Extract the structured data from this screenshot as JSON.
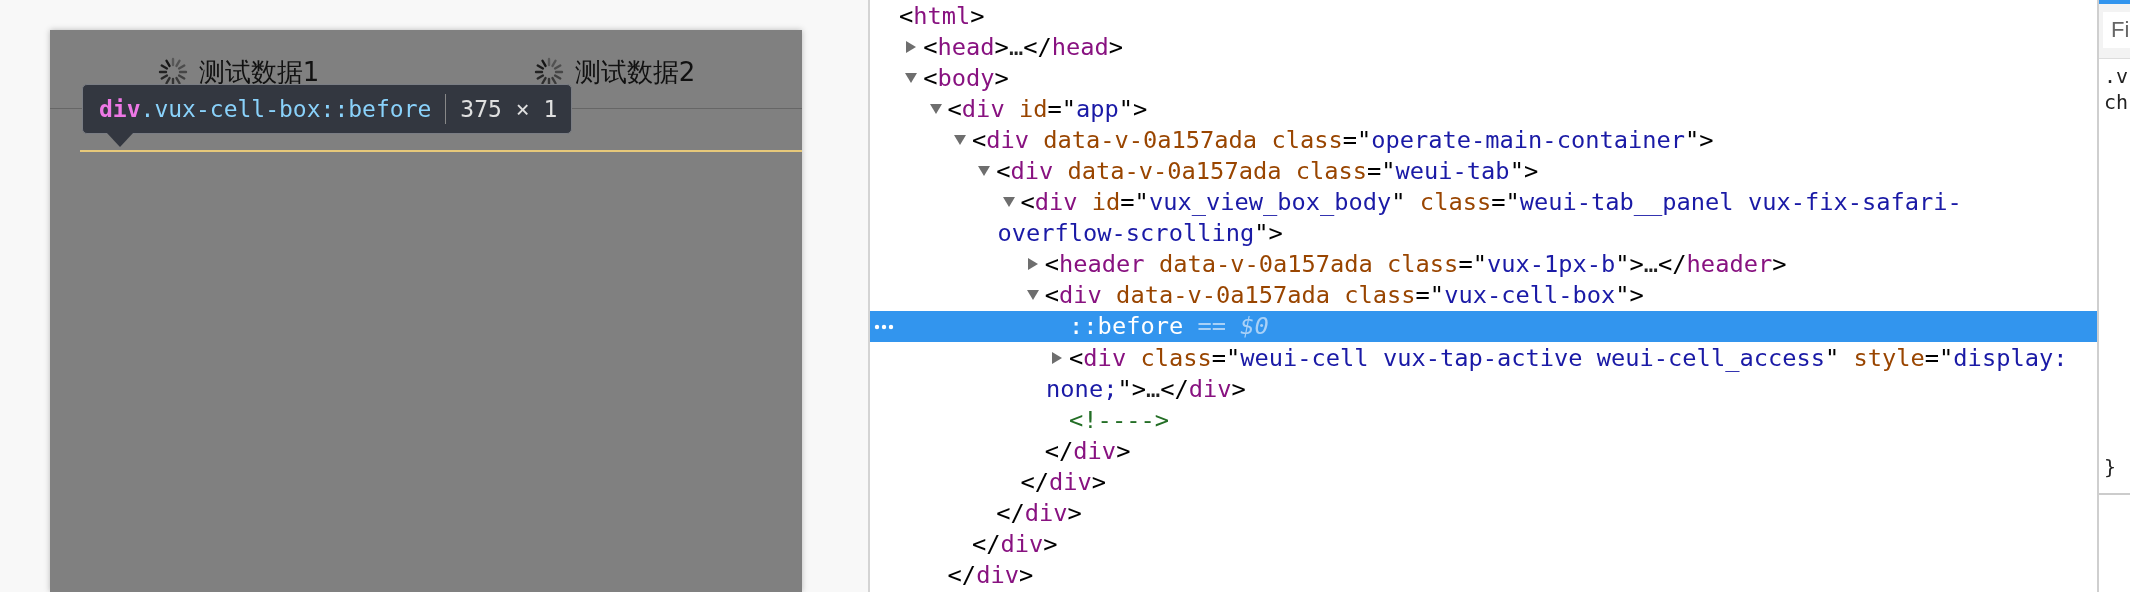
{
  "viewport": {
    "tabs": [
      {
        "label": "测试数据1"
      },
      {
        "label": "测试数据2"
      }
    ]
  },
  "tooltip": {
    "tag": "div",
    "selector": ".vux-cell-box::before",
    "size": "375 × 1"
  },
  "elements": {
    "nodes": [
      {
        "lines": [
          [
            {
              "kind": "punct",
              "text": "<"
            },
            {
              "kind": "tag",
              "text": "html"
            },
            {
              "kind": "punct",
              "text": ">"
            }
          ]
        ],
        "selected": false,
        "children": [
          {
            "expanded": false,
            "selected": false,
            "lines": [
              [
                {
                  "kind": "punct",
                  "text": "<"
                },
                {
                  "kind": "tag",
                  "text": "head"
                },
                {
                  "kind": "punct",
                  "text": ">"
                },
                {
                  "kind": "ellipsis",
                  "text": "…"
                },
                {
                  "kind": "punct",
                  "text": "</"
                },
                {
                  "kind": "tag",
                  "text": "head"
                },
                {
                  "kind": "punct",
                  "text": ">"
                }
              ]
            ]
          },
          {
            "expanded": true,
            "selected": false,
            "lines": [
              [
                {
                  "kind": "punct",
                  "text": "<"
                },
                {
                  "kind": "tag",
                  "text": "body"
                },
                {
                  "kind": "punct",
                  "text": ">"
                }
              ]
            ],
            "children": [
              {
                "expanded": true,
                "selected": false,
                "lines": [
                  [
                    {
                      "kind": "punct",
                      "text": "<"
                    },
                    {
                      "kind": "tag",
                      "text": "div"
                    },
                    {
                      "kind": "attr",
                      "text": " id"
                    },
                    {
                      "kind": "punct",
                      "text": "=\""
                    },
                    {
                      "kind": "value",
                      "text": "app"
                    },
                    {
                      "kind": "punct",
                      "text": "\">"
                    }
                  ]
                ],
                "close": [
                  {
                    "kind": "punct",
                    "text": "</"
                  },
                  {
                    "kind": "tag",
                    "text": "div"
                  },
                  {
                    "kind": "punct",
                    "text": ">"
                  }
                ],
                "children": [
                  {
                    "expanded": true,
                    "selected": false,
                    "lines": [
                      [
                        {
                          "kind": "punct",
                          "text": "<"
                        },
                        {
                          "kind": "tag",
                          "text": "div"
                        },
                        {
                          "kind": "attr",
                          "text": " data-v-0a157ada class"
                        },
                        {
                          "kind": "punct",
                          "text": "=\""
                        },
                        {
                          "kind": "value",
                          "text": "operate-main-container"
                        },
                        {
                          "kind": "punct",
                          "text": "\">"
                        }
                      ]
                    ],
                    "close": [
                      {
                        "kind": "punct",
                        "text": "</"
                      },
                      {
                        "kind": "tag",
                        "text": "div"
                      },
                      {
                        "kind": "punct",
                        "text": ">"
                      }
                    ],
                    "children": [
                      {
                        "expanded": true,
                        "selected": false,
                        "lines": [
                          [
                            {
                              "kind": "punct",
                              "text": "<"
                            },
                            {
                              "kind": "tag",
                              "text": "div"
                            },
                            {
                              "kind": "attr",
                              "text": " data-v-0a157ada class"
                            },
                            {
                              "kind": "punct",
                              "text": "=\""
                            },
                            {
                              "kind": "value",
                              "text": "weui-tab"
                            },
                            {
                              "kind": "punct",
                              "text": "\">"
                            }
                          ]
                        ],
                        "close": [
                          {
                            "kind": "punct",
                            "text": "</"
                          },
                          {
                            "kind": "tag",
                            "text": "div"
                          },
                          {
                            "kind": "punct",
                            "text": ">"
                          }
                        ],
                        "children": [
                          {
                            "expanded": true,
                            "selected": false,
                            "lines": [
                              [
                                {
                                  "kind": "punct",
                                  "text": "<"
                                },
                                {
                                  "kind": "tag",
                                  "text": "div"
                                },
                                {
                                  "kind": "attr",
                                  "text": " id"
                                },
                                {
                                  "kind": "punct",
                                  "text": "=\""
                                },
                                {
                                  "kind": "value",
                                  "text": "vux_view_box_body"
                                },
                                {
                                  "kind": "punct",
                                  "text": "\""
                                },
                                {
                                  "kind": "attr",
                                  "text": " class"
                                },
                                {
                                  "kind": "punct",
                                  "text": "=\""
                                },
                                {
                                  "kind": "value",
                                  "text": "weui-tab__panel vux-fix-safari-"
                                }
                              ],
                              [
                                {
                                  "kind": "value",
                                  "text": "overflow-scrolling"
                                },
                                {
                                  "kind": "punct",
                                  "text": "\">"
                                }
                              ]
                            ],
                            "close": [
                              {
                                "kind": "punct",
                                "text": "</"
                              },
                              {
                                "kind": "tag",
                                "text": "div"
                              },
                              {
                                "kind": "punct",
                                "text": ">"
                              }
                            ],
                            "children": [
                              {
                                "expanded": false,
                                "selected": false,
                                "lines": [
                                  [
                                    {
                                      "kind": "punct",
                                      "text": "<"
                                    },
                                    {
                                      "kind": "tag",
                                      "text": "header"
                                    },
                                    {
                                      "kind": "attr",
                                      "text": " data-v-0a157ada class"
                                    },
                                    {
                                      "kind": "punct",
                                      "text": "=\""
                                    },
                                    {
                                      "kind": "value",
                                      "text": "vux-1px-b"
                                    },
                                    {
                                      "kind": "punct",
                                      "text": "\">"
                                    },
                                    {
                                      "kind": "ellipsis",
                                      "text": "…"
                                    },
                                    {
                                      "kind": "punct",
                                      "text": "</"
                                    },
                                    {
                                      "kind": "tag",
                                      "text": "header"
                                    },
                                    {
                                      "kind": "punct",
                                      "text": ">"
                                    }
                                  ]
                                ]
                              },
                              {
                                "expanded": true,
                                "selected": false,
                                "lines": [
                                  [
                                    {
                                      "kind": "punct",
                                      "text": "<"
                                    },
                                    {
                                      "kind": "tag",
                                      "text": "div"
                                    },
                                    {
                                      "kind": "attr",
                                      "text": " data-v-0a157ada class"
                                    },
                                    {
                                      "kind": "punct",
                                      "text": "=\""
                                    },
                                    {
                                      "kind": "value",
                                      "text": "vux-cell-box"
                                    },
                                    {
                                      "kind": "punct",
                                      "text": "\">"
                                    }
                                  ]
                                ],
                                "close": [
                                  {
                                    "kind": "punct",
                                    "text": "</"
                                  },
                                  {
                                    "kind": "tag",
                                    "text": "div"
                                  },
                                  {
                                    "kind": "punct",
                                    "text": ">"
                                  }
                                ],
                                "children": [
                                  {
                                    "selected": true,
                                    "lines": [
                                      [
                                        {
                                          "kind": "pseudo",
                                          "text": "::before"
                                        },
                                        {
                                          "kind": "ref",
                                          "text": " == $0"
                                        }
                                      ]
                                    ]
                                  },
                                  {
                                    "expanded": false,
                                    "selected": false,
                                    "lines": [
                                      [
                                        {
                                          "kind": "punct",
                                          "text": "<"
                                        },
                                        {
                                          "kind": "tag",
                                          "text": "div"
                                        },
                                        {
                                          "kind": "attr",
                                          "text": " class"
                                        },
                                        {
                                          "kind": "punct",
                                          "text": "=\""
                                        },
                                        {
                                          "kind": "value",
                                          "text": "weui-cell vux-tap-active weui-cell_access"
                                        },
                                        {
                                          "kind": "punct",
                                          "text": "\""
                                        },
                                        {
                                          "kind": "attr",
                                          "text": " style"
                                        },
                                        {
                                          "kind": "punct",
                                          "text": "=\""
                                        },
                                        {
                                          "kind": "value",
                                          "text": "display:"
                                        }
                                      ],
                                      [
                                        {
                                          "kind": "value",
                                          "text": "none;"
                                        },
                                        {
                                          "kind": "punct",
                                          "text": "\">"
                                        },
                                        {
                                          "kind": "ellipsis",
                                          "text": "…"
                                        },
                                        {
                                          "kind": "punct",
                                          "text": "</"
                                        },
                                        {
                                          "kind": "tag",
                                          "text": "div"
                                        },
                                        {
                                          "kind": "punct",
                                          "text": ">"
                                        }
                                      ]
                                    ]
                                  },
                                  {
                                    "selected": false,
                                    "lines": [
                                      [
                                        {
                                          "kind": "comment",
                                          "text": "<!---->"
                                        }
                                      ]
                                    ]
                                  }
                                ]
                              }
                            ]
                          }
                        ]
                      }
                    ]
                  }
                ]
              }
            ]
          }
        ]
      }
    ]
  },
  "styles": {
    "filter": {
      "placeholder": "Fi"
    },
    "rule_lines": [
      ".v",
      "ch"
    ],
    "closing_brace": "}"
  }
}
